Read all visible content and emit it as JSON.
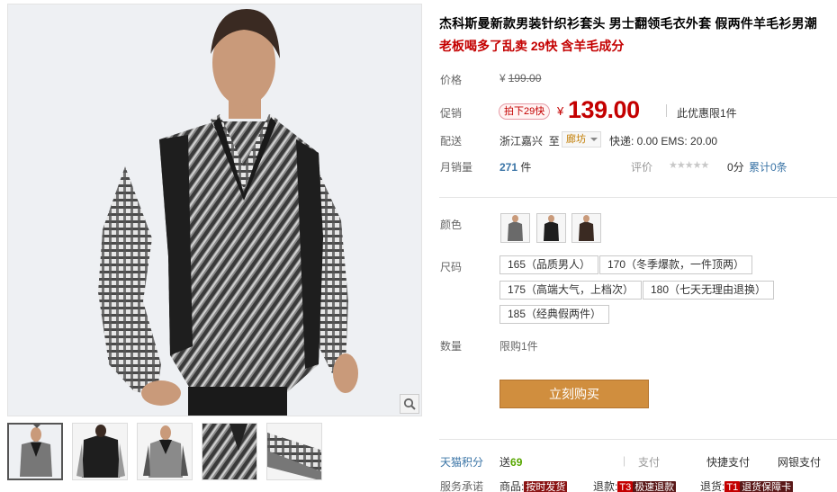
{
  "product": {
    "title": "杰科斯曼新款男装针织衫套头 男士翻领毛衣外套 假两件羊毛衫男潮",
    "subtitle": "老板喝多了乱卖 29快 含羊毛成分"
  },
  "gallery": {
    "zoom_icon": "magnifier-icon",
    "thumbnails": [
      "front-view",
      "back-view",
      "side-view",
      "fabric-detail",
      "cuff-detail"
    ]
  },
  "price": {
    "label": "价格",
    "currency": "¥",
    "original": "199.00"
  },
  "promo": {
    "label": "促销",
    "tag": "拍下29快",
    "currency": "¥",
    "price": "139.00",
    "limit": "此优惠限1件"
  },
  "shipping": {
    "label": "配送",
    "from": "浙江嘉兴",
    "to_word": "至",
    "to": "廊坊",
    "fee": "快递: 0.00 EMS: 20.00"
  },
  "sales": {
    "label": "月销量",
    "count": "271",
    "unit": "件",
    "rating_label": "评价",
    "stars": "★★★★★",
    "score": "0分",
    "reviews": "累计0条"
  },
  "color": {
    "label": "颜色",
    "options": [
      "grey-stripe",
      "black-plaid",
      "brown-plaid"
    ]
  },
  "size": {
    "label": "尺码",
    "options": [
      "165（品质男人）",
      "170（冬季爆款，一件顶两）",
      "175（高端大气，上档次）",
      "180（七天无理由退换）",
      "185（经典假两件）"
    ]
  },
  "quantity": {
    "label": "数量",
    "limit": "限购1件"
  },
  "buy_button": "立刻购买",
  "tmall_points": {
    "label": "天猫积分",
    "prefix": "送",
    "value": "69"
  },
  "payment": {
    "sep": "|",
    "label": "支付",
    "fast": "快捷支付",
    "bank": "网银支付"
  },
  "service": {
    "label": "服务承诺",
    "items": [
      {
        "prefix": "商品:",
        "badge": "按时发货"
      },
      {
        "prefix": "退款:",
        "code": "T3",
        "badge": "极速退款"
      },
      {
        "prefix": "退货:",
        "code": "T1",
        "badge": "退货保障卡"
      }
    ]
  },
  "colors": {
    "accent_red": "#c40000",
    "buy_button": "#d08e3e",
    "link_blue": "#3a74a6",
    "points_green": "#57a600"
  }
}
